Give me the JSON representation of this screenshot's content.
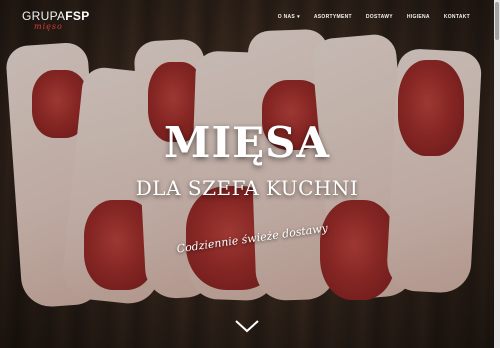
{
  "brand": {
    "name_prefix": "GRUPA",
    "name_suffix": "FSP",
    "tagline": "mięso",
    "accent_color": "#d43b3b"
  },
  "nav": {
    "items": [
      {
        "label": "O NAS",
        "has_dropdown": true
      },
      {
        "label": "ASORTYMENT",
        "has_dropdown": false
      },
      {
        "label": "DOSTAWY",
        "has_dropdown": false
      },
      {
        "label": "HIGIENA",
        "has_dropdown": false
      },
      {
        "label": "KONTAKT",
        "has_dropdown": false
      }
    ]
  },
  "hero": {
    "title": "MIĘSA",
    "subtitle": "DLA SZEFA KUCHNI",
    "tagline": "Codziennie świeże dostawy",
    "scroll_icon": "chevron-down-icon"
  }
}
